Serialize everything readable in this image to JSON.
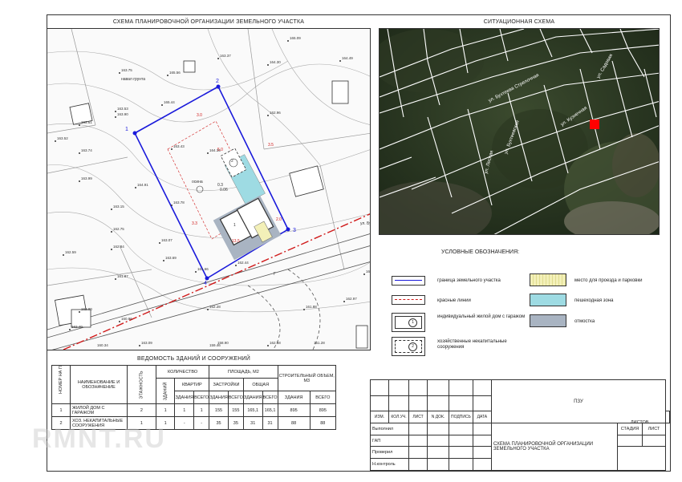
{
  "plan_title": "СХЕМА ПЛАНИРОВОЧНОЙ ОРГАНИЗАЦИИ ЗЕМЕЛЬНОГО УЧАСТКА",
  "situation_title": "СИТУАЦИОННАЯ СХЕМА",
  "plan": {
    "corners": [
      "1",
      "2",
      "3",
      "4"
    ],
    "elevations": [
      "163.75",
      "165.56",
      "163.37",
      "164.30",
      "165.09",
      "164.49",
      "163.53",
      "165.44",
      "163.61",
      "163.90",
      "163.52",
      "163.74",
      "163.43",
      "164.35",
      "162.96",
      "163.99",
      "164.91",
      "163.78",
      "163.15",
      "162.75",
      "163.07",
      "162.84",
      "162.59",
      "163.69",
      "162.44",
      "161.66",
      "162.28",
      "161.87",
      "163.41",
      "160.96",
      "162.00",
      "162.40",
      "163.09",
      "162.97",
      "161.88",
      "162.88",
      "160.34",
      "159.46",
      "158.90",
      "161.28"
    ],
    "labels": {
      "ground_note": "навал грунта",
      "tree": "осина",
      "tree_size": "0.3",
      "tree_h": "0.06",
      "street": "ул. Бухт",
      "road_mark": "Г",
      "n1": "1",
      "n2": "2"
    },
    "dims": [
      "3.0",
      "5.0",
      "13.5",
      "3.3",
      "3.5",
      "2.0"
    ]
  },
  "situation": {
    "streets": [
      "ул. Бухтеева Стрелочная",
      "ул. Кузнечная",
      "ул. Бухтеевская",
      "ул. Садовая",
      "ул. Лесная"
    ]
  },
  "legend": {
    "title": "УСЛОВНЫЕ ОБОЗНАЧЕНИЯ:",
    "items": [
      {
        "label": "граница земельного участка"
      },
      {
        "label": "красные линии"
      },
      {
        "label": "индивидуальный жилой дом с гаражом",
        "num": "1"
      },
      {
        "label": "хозяйственные некапитальные сооружения",
        "num": "2"
      },
      {
        "label": "место для проезда и парковки"
      },
      {
        "label": "пешеходная зона"
      },
      {
        "label": "отмостка"
      }
    ]
  },
  "buildings_table": {
    "title": "ВЕДОМОСТЬ ЗДАНИЙ И СООРУЖЕНИЙ",
    "h_num": "НОМЕР НА ПЛАНЕ",
    "h_name": "НАИМЕНОВАНИЕ И ОБОЗНАЧЕНИЕ",
    "h_floors": "ЭТАЖНОСТЬ",
    "h_qty": "КОЛИЧЕСТВО",
    "h_bldg": "ЗДАНИЙ",
    "h_apts": "КВАРТИР",
    "h_bldg2": "ЗДАНИЯ",
    "h_total": "ВСЕГО",
    "h_area": "ПЛОЩАДЬ, М2",
    "h_built": "ЗАСТРОЙКИ",
    "h_gen": "ОБЩАЯ",
    "h_vol": "СТРОИТЕЛЬНЫЙ ОБЪЕМ, М3",
    "rows": [
      [
        "1",
        "ЖИЛОЙ ДОМ С ГАРАЖОМ",
        "2",
        "1",
        "1",
        "1",
        "155",
        "155",
        "165,1",
        "165,1",
        "895",
        "895"
      ],
      [
        "2",
        "ХОЗ. НЕКАПИТАЛЬНЫЕ СООРУЖЕНИЯ",
        "1",
        "1",
        "-",
        "-",
        "35",
        "35",
        "31",
        "31",
        "88",
        "88"
      ]
    ]
  },
  "stamp": {
    "code": "ПЗУ",
    "cols": [
      "ИЗМ.",
      "КОЛ.УЧ.",
      "ЛИСТ",
      "N ДОК.",
      "ПОДПИСЬ",
      "ДАТА"
    ],
    "roles": [
      "Выполнил",
      "ГАП",
      "Проверил",
      "Н.контроль"
    ],
    "stage_labels": [
      "СТАДИЯ",
      "ЛИСТ",
      "ЛИСТОВ"
    ],
    "sheet_title": "СХЕМА ПЛАНИРОВОЧНОЙ ОРГАНИЗАЦИИ ЗЕМЕЛЬНОГО УЧАСТКА"
  },
  "watermark": "RMNT.RU",
  "colors": {
    "boundary": "#1a1adb",
    "red_line": "#d01a1a",
    "pedestrian": "#9edbe3",
    "blind_area": "#a9b4c2",
    "parking": "#f3f0b8",
    "building": "#333333"
  }
}
